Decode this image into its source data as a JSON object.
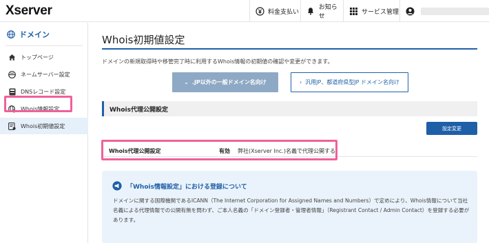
{
  "header": {
    "logo": "Xserver",
    "nav": [
      {
        "label": "料金支払い",
        "icon": "yen-icon"
      },
      {
        "label": "お知らせ",
        "icon": "bell-icon"
      },
      {
        "label": "サービス管理",
        "icon": "grid-icon"
      }
    ],
    "user_icon": "user-icon"
  },
  "sidebar": {
    "heading": "ドメイン",
    "heading_icon": "globe-icon",
    "items": [
      {
        "label": "トップページ",
        "icon": "home-icon"
      },
      {
        "label": "ネームサーバー設定",
        "icon": "server-icon"
      },
      {
        "label": "DNSレコード設定",
        "icon": "dns-icon"
      },
      {
        "label": "Whois情報設定",
        "icon": "whois-icon"
      },
      {
        "label": "Whois初期値設定",
        "icon": "whois-default-icon",
        "active": true
      }
    ]
  },
  "main": {
    "title": "Whois初期値設定",
    "description": "ドメインの新規取得時や移管完了時に利用するWhois情報の初期値の確認や変更ができます。",
    "tabs": [
      {
        "label": ".JP以外の一般ドメイン名向け",
        "active": true
      },
      {
        "label": "汎用JP、都道府県型JP ドメイン名向け",
        "active": false
      }
    ],
    "section_title": "Whois代理公開設定",
    "change_button": "設定変更",
    "row": {
      "label": "Whois代理公開設定",
      "status": "有効",
      "detail": "弊社(Xserver Inc.)名義で代理公開する"
    },
    "info": {
      "title": "「Whois情報設定」における登録について",
      "body": "ドメインに関する国際機関であるICANN（The Internet Corporation for Assigned Names and Numbers）で定めにより、Whois情報について当社名義による代理情報での公開有無を問わず、ご本人名義の「ドメイン登録者・管理者情報」（Registrant Contact / Admin Contact）を登録する必要があります。"
    }
  },
  "colors": {
    "brand_blue": "#1f5fa8",
    "highlight_pink": "#f0609a",
    "inactive_tab": "#8ea9c5",
    "info_bg": "#eaf3fb"
  }
}
